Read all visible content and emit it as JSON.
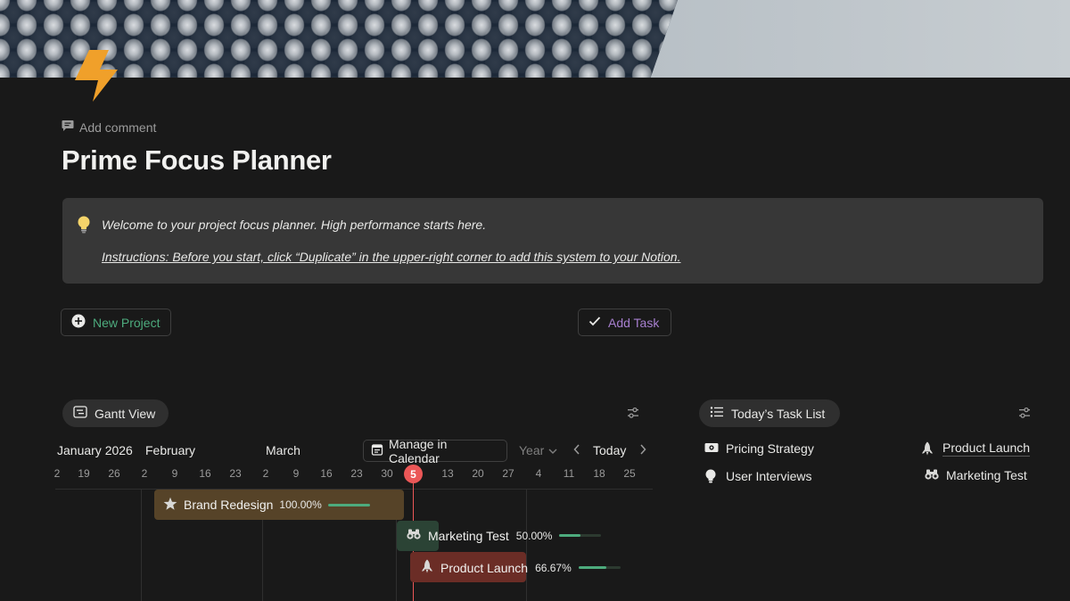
{
  "page": {
    "add_comment": "Add comment",
    "title": "Prime Focus Planner"
  },
  "callout": {
    "icon": "lightbulb-icon",
    "line1": "Welcome to your project focus planner. High performance starts here.",
    "line2": "Instructions: Before you start, click “Duplicate” in the upper-right corner to add this system to your Notion. "
  },
  "buttons": {
    "new_project": "New Project",
    "add_task": "Add Task"
  },
  "colors": {
    "background": "#191919",
    "callout_bg": "#373737",
    "accent_green": "#4dab7d",
    "accent_purple": "#a77fcf",
    "today_red": "#eb5757",
    "brand_bar": "#564328",
    "marketing_bar": "#2b4335",
    "launch_bar": "#6b2d26"
  },
  "gantt": {
    "tab_label": "Gantt View",
    "months": [
      "January 2026",
      "February",
      "March"
    ],
    "manage_calendar": "Manage in Calendar",
    "range": "Year",
    "today_button": "Today",
    "ticks": [
      "2",
      "19",
      "26",
      "2",
      "9",
      "16",
      "23",
      "2",
      "9",
      "16",
      "23",
      "30",
      "13",
      "20",
      "27",
      "4",
      "11",
      "18",
      "25"
    ],
    "today_date": "5",
    "bars": [
      {
        "name": "Brand Redesign",
        "icon": "star-icon",
        "percent": "100.00%",
        "progress": 1.0
      },
      {
        "name": "Marketing Test",
        "icon": "binoculars-icon",
        "percent": "50.00%",
        "progress": 0.5
      },
      {
        "name": "Product Launch",
        "icon": "rocket-icon",
        "percent": "66.67%",
        "progress": 0.6667
      }
    ]
  },
  "today_list": {
    "tab_label": "Today’s Task List",
    "tasks": [
      {
        "name": "Pricing Strategy",
        "icon": "money-icon"
      },
      {
        "name": "Product Launch",
        "icon": "rocket-icon"
      },
      {
        "name": "User Interviews",
        "icon": "bulb-icon"
      },
      {
        "name": "Marketing Test",
        "icon": "binoculars-icon"
      }
    ]
  }
}
